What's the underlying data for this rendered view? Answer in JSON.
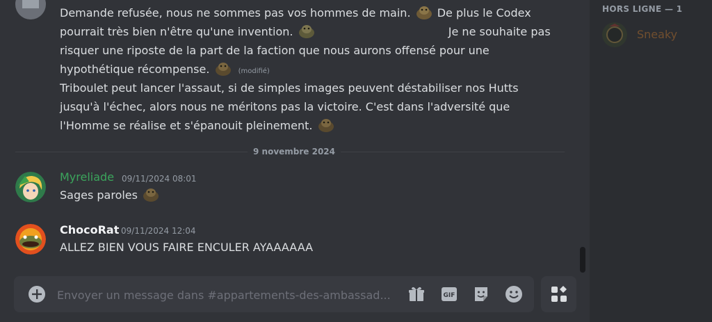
{
  "colors": {
    "chat_bg": "#313338",
    "sidebar_bg": "#2b2d31",
    "composer_bg": "#383a40",
    "text": "#dbdee1",
    "muted": "#949ba4",
    "myreliade_color": "#3ba55c",
    "chocorat_color": "#f2f3f5"
  },
  "messages_top": {
    "m1_line1_a": "Demande refusée, nous ne sommes pas vos hommes de main.",
    "m1_line1_b": "De plus le Codex",
    "m1_line2_a": "pourrait très bien n'être qu'une invention.",
    "m1_line2_b": "Je ne souhaite pas",
    "m1_line3": "risquer une riposte de la part de la faction que nous aurons offensé pour une",
    "m1_line4": "hypothétique récompense.",
    "edited": "(modifié)",
    "m2_line1": "Triboulet peut lancer l'assaut, si de simples images peuvent déstabiliser nos Hutts",
    "m2_line2": "jusqu'à l'échec, alors nous ne méritons pas la victoire. C'est dans l'adversité que",
    "m2_line3": "l'Homme se réalise et s'épanouit pleinement."
  },
  "date_divider": "9 novembre 2024",
  "message_myreliade": {
    "author": "Myreliade",
    "timestamp": "09/11/2024 08:01",
    "text": "Sages paroles"
  },
  "message_chocorat": {
    "author": "ChocoRat",
    "timestamp": "09/11/2024 12:04",
    "text": "ALLEZ BIEN VOUS FAIRE ENCULER AYAAAAAA"
  },
  "composer": {
    "placeholder": "Envoyer un message dans #appartements-des-ambassad..."
  },
  "members": {
    "section_title": "HORS LIGNE — 1",
    "offline_user": "Sneaky"
  },
  "icons": {
    "add": "plus-circle-icon",
    "gift": "gift-icon",
    "gif": "gif-icon",
    "sticker": "sticker-icon",
    "emoji": "smiley-icon",
    "apps": "app-launcher-icon",
    "custom_emoji": "hutt-emoji-icon"
  }
}
